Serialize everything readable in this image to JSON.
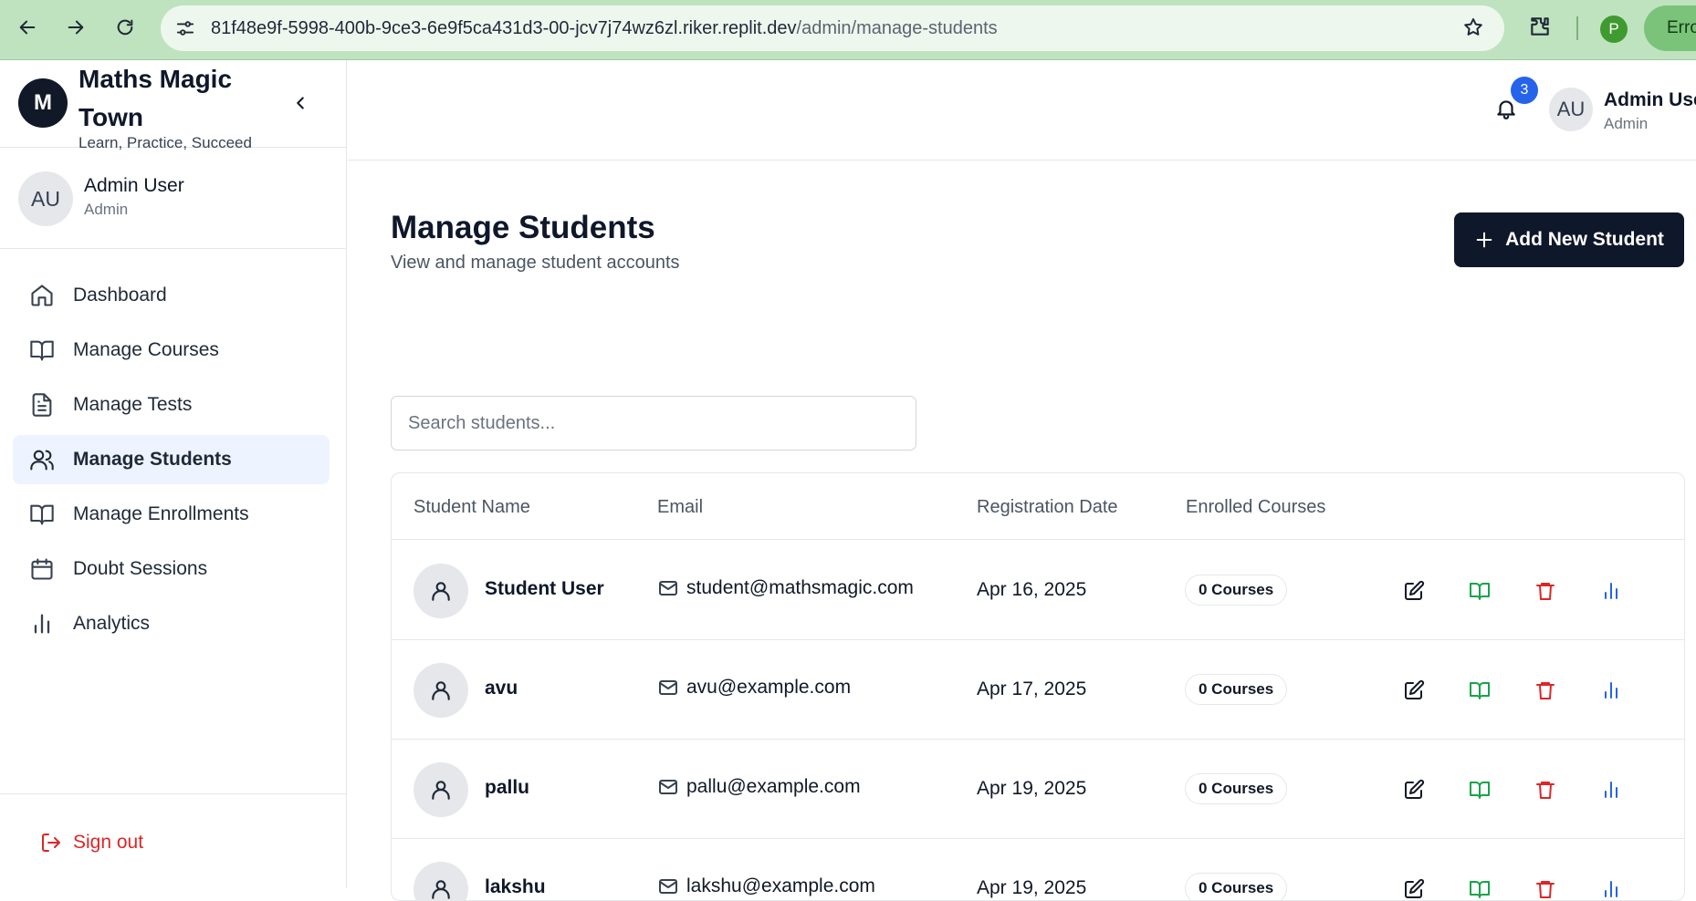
{
  "browser": {
    "url_host": "81f48e9f-5998-400b-9ce3-6e9f5ca431d3-00-jcv7j74wz6zl.riker.replit.dev",
    "url_path": "/admin/manage-students",
    "profile_initial": "P",
    "error_label": "Erro"
  },
  "brand": {
    "logo_letter": "M",
    "name": "Maths Magic Town",
    "tagline": "Learn, Practice, Succeed"
  },
  "sidebar_user": {
    "initials": "AU",
    "name": "Admin User",
    "role": "Admin"
  },
  "menu": [
    {
      "label": "Dashboard",
      "icon": "home-icon",
      "active": false
    },
    {
      "label": "Manage Courses",
      "icon": "book-icon",
      "active": false
    },
    {
      "label": "Manage Tests",
      "icon": "file-text-icon",
      "active": false
    },
    {
      "label": "Manage Students",
      "icon": "users-icon",
      "active": true
    },
    {
      "label": "Manage Enrollments",
      "icon": "book-icon",
      "active": false
    },
    {
      "label": "Doubt Sessions",
      "icon": "calendar-icon",
      "active": false
    },
    {
      "label": "Analytics",
      "icon": "bar-chart-icon",
      "active": false
    }
  ],
  "signout_label": "Sign out",
  "topbar": {
    "notification_count": "3",
    "user_initials": "AU",
    "user_name": "Admin User",
    "user_role": "Admin"
  },
  "page": {
    "title": "Manage Students",
    "subtitle": "View and manage student accounts",
    "add_button_label": "Add New Student",
    "search_placeholder": "Search students..."
  },
  "table": {
    "headers": [
      "Student Name",
      "Email",
      "Registration Date",
      "Enrolled Courses"
    ],
    "rows": [
      {
        "name": "Student User",
        "email": "student@mathsmagic.com",
        "date": "Apr 16, 2025",
        "courses": "0 Courses"
      },
      {
        "name": "avu",
        "email": "avu@example.com",
        "date": "Apr 17, 2025",
        "courses": "0 Courses"
      },
      {
        "name": "pallu",
        "email": "pallu@example.com",
        "date": "Apr 19, 2025",
        "courses": "0 Courses"
      },
      {
        "name": "lakshu",
        "email": "lakshu@example.com",
        "date": "Apr 19, 2025",
        "courses": "0 Courses"
      }
    ]
  },
  "colors": {
    "accent_dark": "#0f172a",
    "active_bg": "#eef4ff",
    "danger": "#dc2626",
    "success": "#16a34a",
    "info": "#2563eb",
    "chrome_green": "#bfe3bf"
  }
}
